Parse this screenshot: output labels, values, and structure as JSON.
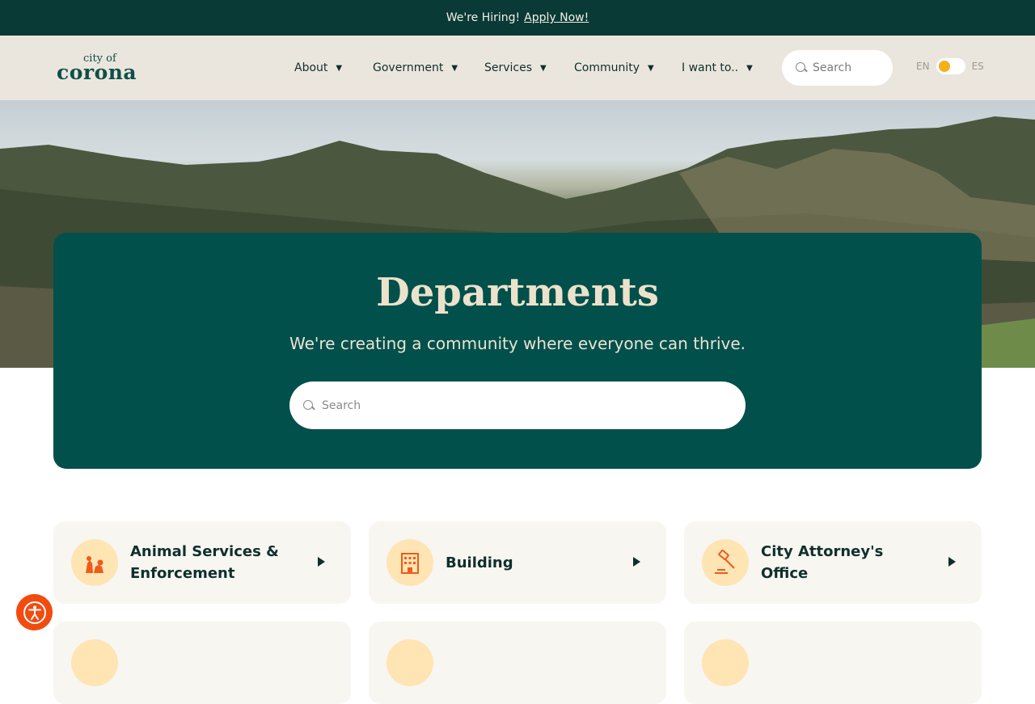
{
  "topbar": {
    "text": "We're Hiring!",
    "link": "Apply Now!"
  },
  "header": {
    "logo": {
      "small": "city of",
      "big": "corona"
    },
    "nav": [
      {
        "label": "About"
      },
      {
        "label": "Government"
      },
      {
        "label": "Services"
      },
      {
        "label": "Community"
      },
      {
        "label": "I want to.."
      }
    ],
    "search_placeholder": "Search",
    "lang": {
      "left": "EN",
      "right": "ES"
    }
  },
  "hero": {
    "title": "Departments",
    "subtitle": "We're creating a community where everyone can thrive.",
    "search_placeholder": "Search"
  },
  "departments": [
    {
      "label": "Animal Services & Enforcement",
      "icon": "animal-services-icon"
    },
    {
      "label": "Building",
      "icon": "building-icon"
    },
    {
      "label": "City Attorney's Office",
      "icon": "gavel-icon"
    }
  ],
  "colors": {
    "topbar_bg": "#0a3a36",
    "header_bg": "#ebe6dd",
    "panel_bg": "#02504b",
    "accent_orange": "#f05a1a",
    "icon_circle": "#ffe4b4",
    "accessibility_button": "#f24b10"
  }
}
